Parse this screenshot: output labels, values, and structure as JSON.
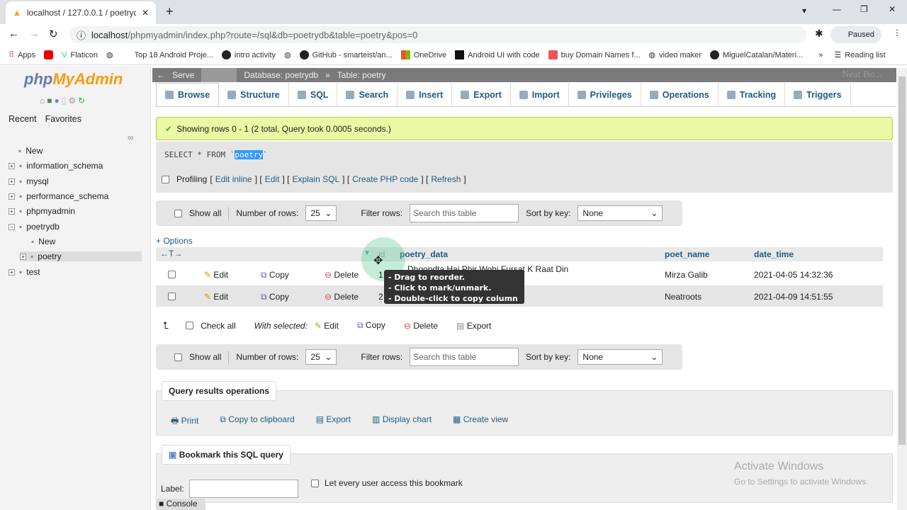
{
  "browser": {
    "tab_title": "localhost / 127.0.0.1 / poetrydb / pc",
    "url_host": "localhost",
    "url_path": "/phpmyadmin/index.php?route=/sql&db=poetrydb&table=poetry&pos=0",
    "profile": "Paused",
    "bookmarks": [
      "Apps",
      "",
      "Flaticon",
      "",
      "Top 18 Android Proje...",
      "intro activity",
      "",
      "GitHub - smarteist/an...",
      "OneDrive",
      "Android UI with code",
      "buy Domain Names f...",
      "video maker",
      "MiguelCatalan/Materi..."
    ],
    "reading_list": "Reading list",
    "more": "»"
  },
  "sidebar": {
    "logo_a": "php",
    "logo_b": "MyAdmin",
    "recent": "Recent",
    "favorites": "Favorites",
    "tree": [
      "New",
      "information_schema",
      "mysql",
      "performance_schema",
      "phpmyadmin",
      "poetrydb",
      "New",
      "poetry",
      "test"
    ]
  },
  "breadcrumb": {
    "server": "Serve",
    "database": "Database: poetrydb",
    "sep": "»",
    "table": "Table: poetry",
    "overlay": "Neat Bo..."
  },
  "tabs": [
    "Browse",
    "Structure",
    "SQL",
    "Search",
    "Insert",
    "Export",
    "Import",
    "Privileges",
    "Operations",
    "Tracking",
    "Triggers"
  ],
  "message": "Showing rows 0 - 1 (2 total, Query took 0.0005 seconds.)",
  "sql": {
    "pre": "SELECT * FROM `",
    "table": "poetry",
    "post": "`"
  },
  "profiling": {
    "label": "Profiling",
    "links": [
      "Edit inline",
      "Edit",
      "Explain SQL",
      "Create PHP code",
      "Refresh"
    ]
  },
  "nav": {
    "show_all": "Show all",
    "rows_label": "Number of rows:",
    "rows": "25",
    "filter_label": "Filter rows:",
    "filter_placeholder": "Search this table",
    "sort_label": "Sort by key:",
    "sort": "None"
  },
  "options": "+ Options",
  "columns": [
    "id",
    "poetry_data",
    "poet_name",
    "date_time"
  ],
  "rows": [
    {
      "id": "1",
      "poetry_data": "Dhoondta Hai Phir Wohi Fursat K Raat Din",
      "poet_name": "Mirza Galib",
      "date_time": "2021-04-05 14:32:36"
    },
    {
      "id": "2",
      "poetry_data": "",
      "poet_name": "Neatroots",
      "date_time": "2021-04-09 14:51:55"
    }
  ],
  "row_actions": {
    "edit": "Edit",
    "copy": "Copy",
    "delete": "Delete"
  },
  "tooltip": [
    "- Drag to reorder.",
    "- Click to mark/unmark.",
    "- Double-click to copy column name."
  ],
  "bulk": {
    "check_all": "Check all",
    "with_selected": "With selected:",
    "edit": "Edit",
    "copy": "Copy",
    "delete": "Delete",
    "export": "Export"
  },
  "qro": {
    "title": "Query results operations",
    "items": [
      "Print",
      "Copy to clipboard",
      "Export",
      "Display chart",
      "Create view"
    ]
  },
  "bookmark": {
    "title": "Bookmark this SQL query",
    "label": "Label:",
    "public": "Let every user access this bookmark"
  },
  "console": "Console",
  "watermark": {
    "title": "Activate Windows",
    "sub": "Go to Settings to activate Windows."
  }
}
